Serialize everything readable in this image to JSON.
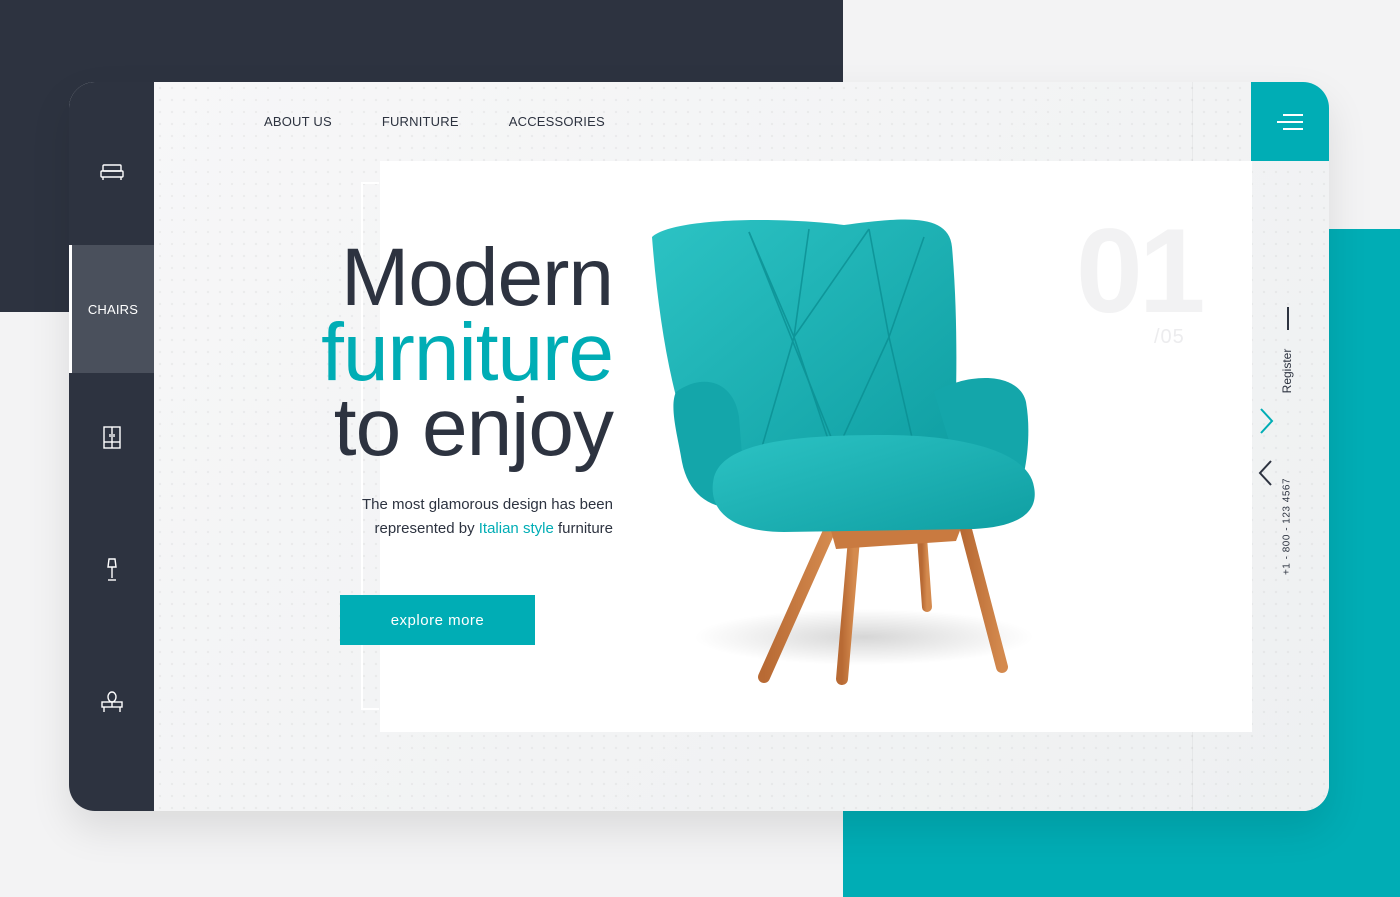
{
  "nav": {
    "links": [
      "ABOUT US",
      "FURNITURE",
      "ACCESSORIES"
    ]
  },
  "sidebar": {
    "items": [
      {
        "icon": "bed-icon"
      },
      {
        "label": "CHAIRS",
        "active": true
      },
      {
        "icon": "wardrobe-icon"
      },
      {
        "icon": "lamp-icon"
      },
      {
        "icon": "dresser-icon"
      }
    ]
  },
  "hero": {
    "line1": "Modern",
    "line2": "furniture",
    "line3": "to enjoy",
    "desc_line1": "The most glamorous design has been",
    "desc_prefix": "represented by",
    "desc_accent": "Italian style",
    "desc_suffix": "furniture",
    "cta": "explore more",
    "slide_number": "01",
    "slide_total": "/05"
  },
  "side": {
    "register": "Register",
    "phone": "+1 - 800 - 123 4567"
  },
  "colors": {
    "accent": "#00adb5",
    "dark": "#2d3340"
  }
}
